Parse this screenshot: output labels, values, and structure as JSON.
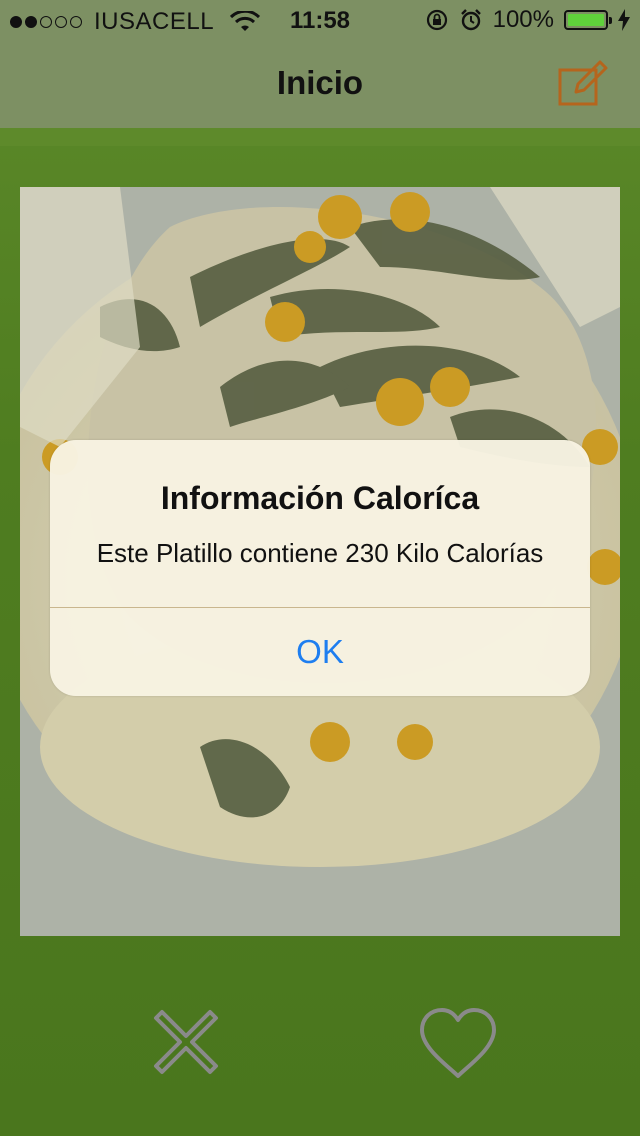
{
  "status_bar": {
    "carrier": "IUSACELL",
    "time": "11:58",
    "battery_percent": "100%",
    "signal_bars_filled": 2,
    "signal_bars_total": 5
  },
  "navbar": {
    "title": "Inicio",
    "compose_icon": "compose-icon"
  },
  "colors": {
    "navbar": "#7d9063",
    "background": "#4e7a1f",
    "alert_background": "#f7f3e2",
    "ok_button": "#1e7ef0",
    "accent_icon": "#b5651d",
    "action_icon": "#8a8a8a"
  },
  "actions": {
    "reject_icon": "x-icon",
    "like_icon": "heart-icon"
  },
  "alert": {
    "title": "Información Caloríca",
    "message": "Este Platillo contiene 230 Kilo Calorías",
    "ok_label": "OK"
  }
}
